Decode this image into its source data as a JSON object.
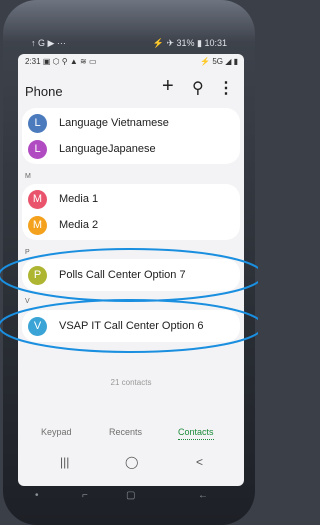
{
  "outer_status": {
    "left": "↑ G ▶ ···",
    "right": "⚡ ✈ 31% ▮ 10:31"
  },
  "status_bar": {
    "time": "2:31",
    "icons": "▣ ⬡ ⚲ ▲ ≋ ▭",
    "right": "⚡ 5G ◢ ▮"
  },
  "app": {
    "title": "Phone",
    "add_glyph": "+",
    "search_glyph": "⚲",
    "more_glyph": "⋮"
  },
  "contacts": {
    "group_l": [
      {
        "initial": "L",
        "name": "Language Vietnamese",
        "color": "#4c7bbd"
      },
      {
        "initial": "L",
        "name": "LanguageJapanese",
        "color": "#b04bc2"
      }
    ],
    "section_m": "M",
    "group_m": [
      {
        "initial": "M",
        "name": "Media 1",
        "color": "#e9546c"
      },
      {
        "initial": "M",
        "name": "Media 2",
        "color": "#f4a11d"
      }
    ],
    "section_p": "P",
    "group_p": [
      {
        "initial": "P",
        "name": "Polls Call Center Option 7",
        "color": "#aeb530"
      }
    ],
    "section_v": "V",
    "group_v": [
      {
        "initial": "V",
        "name": "VSAP IT Call Center Option 6",
        "color": "#3aa4d6"
      }
    ],
    "count": "21 contacts"
  },
  "tabs": [
    "Keypad",
    "Recents",
    "Contacts"
  ],
  "nav": {
    "recents": "|||",
    "home": "◯",
    "back": "<"
  },
  "hw_nav": {
    "a": "•",
    "b": "⌐",
    "c": "▢",
    "d": "←"
  },
  "highlight_color": "#1a8fe0"
}
